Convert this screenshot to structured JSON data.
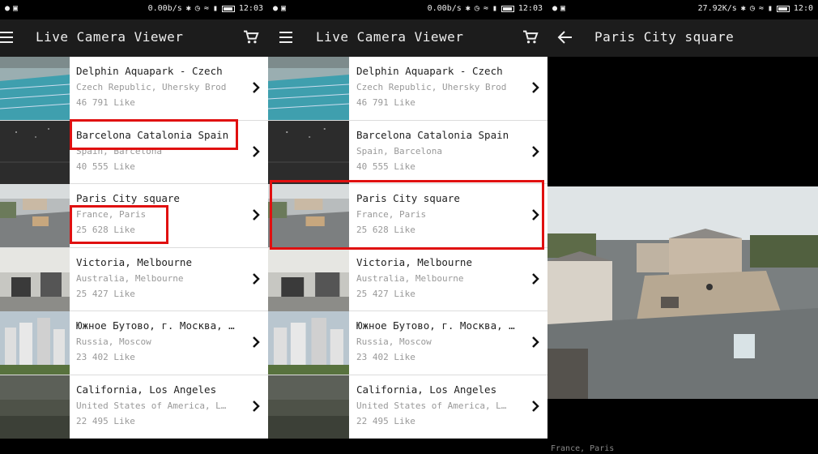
{
  "status_bar_1": {
    "net_speed": "0.00b/s",
    "time": "12:03"
  },
  "status_bar_2": {
    "net_speed": "0.00b/s",
    "time": "12:03"
  },
  "status_bar_3": {
    "net_speed": "27.92K/s",
    "time": "12:0"
  },
  "app": {
    "title": "Live Camera Viewer"
  },
  "detail": {
    "title": "Paris City square",
    "caption": "France, Paris"
  },
  "colors": {
    "highlight": "#e01010",
    "app_bar": "#1c1c1c",
    "background": "#000000",
    "list_bg": "#ffffff"
  },
  "cameras": [
    {
      "title": "Delphin Aquapark  - Czech",
      "subtitle": "Czech Republic, Uhersky Brod",
      "likes": "46 791 Like",
      "thumb": "aquapark"
    },
    {
      "title": "Barcelona Catalonia Spain",
      "subtitle": "Spain, Barcelona",
      "likes": "40 555 Like",
      "thumb": "night"
    },
    {
      "title": "Paris City square",
      "subtitle": "France, Paris",
      "likes": "25 628 Like",
      "thumb": "paris"
    },
    {
      "title": "Victoria, Melbourne",
      "subtitle": "Australia, Melbourne",
      "likes": "25 427 Like",
      "thumb": "office"
    },
    {
      "title": "Южное Бутово, г. Москва, …",
      "subtitle": "Russia, Moscow",
      "likes": "23 402 Like",
      "thumb": "moscow"
    },
    {
      "title": "California, Los Angeles",
      "subtitle": "United States of America, L…",
      "likes": "22 495 Like",
      "thumb": "la"
    }
  ]
}
